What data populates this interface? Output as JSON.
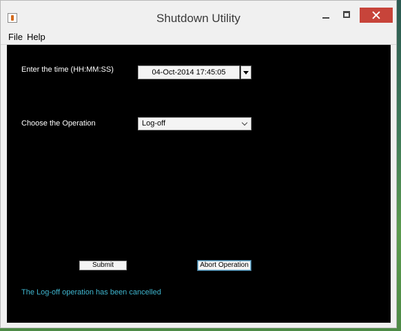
{
  "window": {
    "title": "Shutdown Utility"
  },
  "menu": {
    "file": "File",
    "help": "Help"
  },
  "form": {
    "time_label": "Enter the time (HH:MM:SS)",
    "time_value": "04-Oct-2014 17:45:05",
    "operation_label": "Choose the Operation",
    "operation_value": "Log-off"
  },
  "buttons": {
    "submit": "Submit",
    "abort": "Abort Operation"
  },
  "status": {
    "message": "The Log-off operation has been cancelled"
  },
  "colors": {
    "panel_bg": "#000000",
    "status_text": "#3fb6cf",
    "close_button": "#c7443a"
  }
}
